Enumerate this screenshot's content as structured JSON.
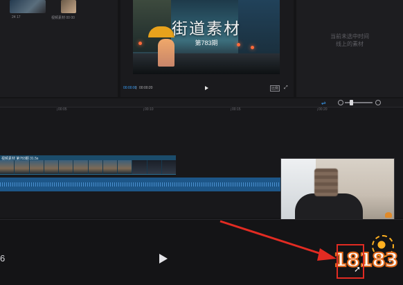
{
  "media": {
    "thumb1_label": "24 17",
    "thumb2_label": "视频素材 00 00"
  },
  "player": {
    "title": "街道素材",
    "subtitle": "第783期",
    "current_time": "00:00:00",
    "total_time": "00:00:20",
    "ratio_label": "比例"
  },
  "details": {
    "hint_line1": "当前未选中时间",
    "hint_line2": "线上的素材"
  },
  "timeline": {
    "ruler": [
      "00:05",
      "00:10",
      "00:15",
      "00:20"
    ],
    "clip_label": "视频素材 第783期  31.5s"
  },
  "bottom": {
    "timecode": "6",
    "watermark": "18183"
  },
  "colors": {
    "accent": "#3aa3ff",
    "highlight_red": "#e22b22",
    "logo_orange": "#e36a1a"
  },
  "icons": {
    "play": "play-icon",
    "fullscreen": "fullscreen-icon",
    "zoom_in": "zoom-in-icon",
    "zoom_out": "zoom-out-icon",
    "cursor": "cursor-icon"
  }
}
